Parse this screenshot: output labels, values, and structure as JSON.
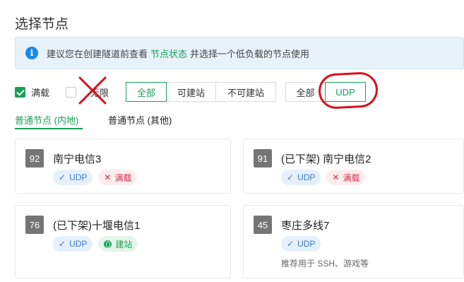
{
  "page": {
    "title": "选择节点"
  },
  "alert": {
    "icon": "info-icon",
    "prefix": "建议您在创建隧道前查看",
    "link": "节点状态",
    "suffix": "并选择一个低负载的节点使用"
  },
  "filters": {
    "full_label": "满载",
    "full_checked": true,
    "unlimited_label": "无限",
    "unlimited_checked": false,
    "build_group": [
      "全部",
      "可建站",
      "不可建站"
    ],
    "build_selected": "全部",
    "protocol_group": [
      "全部",
      "UDP"
    ],
    "protocol_selected": "UDP"
  },
  "tabs": [
    {
      "label": "普通节点 (内地)",
      "active": true
    },
    {
      "label": "普通节点 (其他)",
      "active": false
    }
  ],
  "nodes": [
    {
      "id": "92",
      "name": "南宁电信3",
      "tags": [
        "UDP",
        "满载"
      ],
      "note": ""
    },
    {
      "id": "91",
      "name": "(已下架) 南宁电信2",
      "tags": [
        "UDP",
        "满载"
      ],
      "note": ""
    },
    {
      "id": "76",
      "name": "(已下架)十堰电信1",
      "tags": [
        "UDP",
        "建站"
      ],
      "note": ""
    },
    {
      "id": "45",
      "name": "枣庄多线7",
      "tags": [
        "UDP"
      ],
      "note": "推荐用于 SSH、游戏等"
    }
  ],
  "colors": {
    "accent": "#18a058",
    "info": "#1e88e5",
    "annotation": "#d8101c"
  }
}
